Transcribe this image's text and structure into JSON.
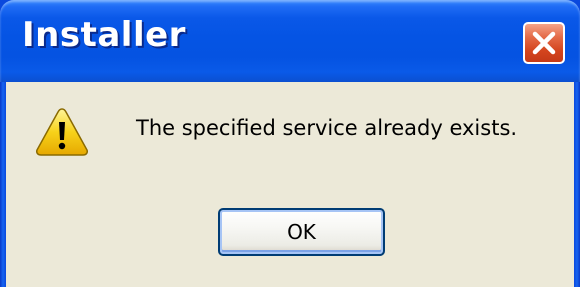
{
  "window": {
    "title": "Installer"
  },
  "dialog": {
    "message": "The specified service already exists.",
    "ok_label": "OK",
    "icon": "warning-icon"
  },
  "colors": {
    "titlebar": "#0554e4",
    "client_background": "#ece9d8",
    "close_button": "#d4451e",
    "warning_yellow": "#f7d21a"
  }
}
